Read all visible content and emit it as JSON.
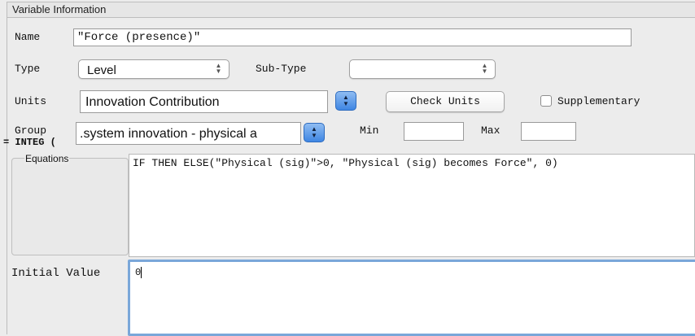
{
  "group_title": "Variable Information",
  "name": {
    "label": "Name",
    "value": "\"Force (presence)\""
  },
  "type": {
    "label": "Type",
    "value": "Level"
  },
  "subtype": {
    "label": "Sub-Type",
    "value": ""
  },
  "units": {
    "label": "Units",
    "value": "Innovation Contribution",
    "check_button": "Check Units",
    "supplementary_label": "Supplementary"
  },
  "group": {
    "label": "Group",
    "value": ".system innovation - physical a"
  },
  "min": {
    "label": "Min",
    "value": ""
  },
  "max": {
    "label": "Max",
    "value": ""
  },
  "integ_label": "= INTEG (",
  "equations": {
    "label": "Equations",
    "value": "IF THEN ELSE(\"Physical (sig)\">0, \"Physical (sig) becomes Force\", 0)"
  },
  "initial_value": {
    "label": "Initial Value",
    "value": "0"
  },
  "icons": {
    "select_arrows": "up-down-arrows-icon",
    "stepper": "blue-stepper-icon"
  },
  "colors": {
    "focus_ring": "#7aa7d9",
    "stepper_blue": "#3f86e3"
  }
}
